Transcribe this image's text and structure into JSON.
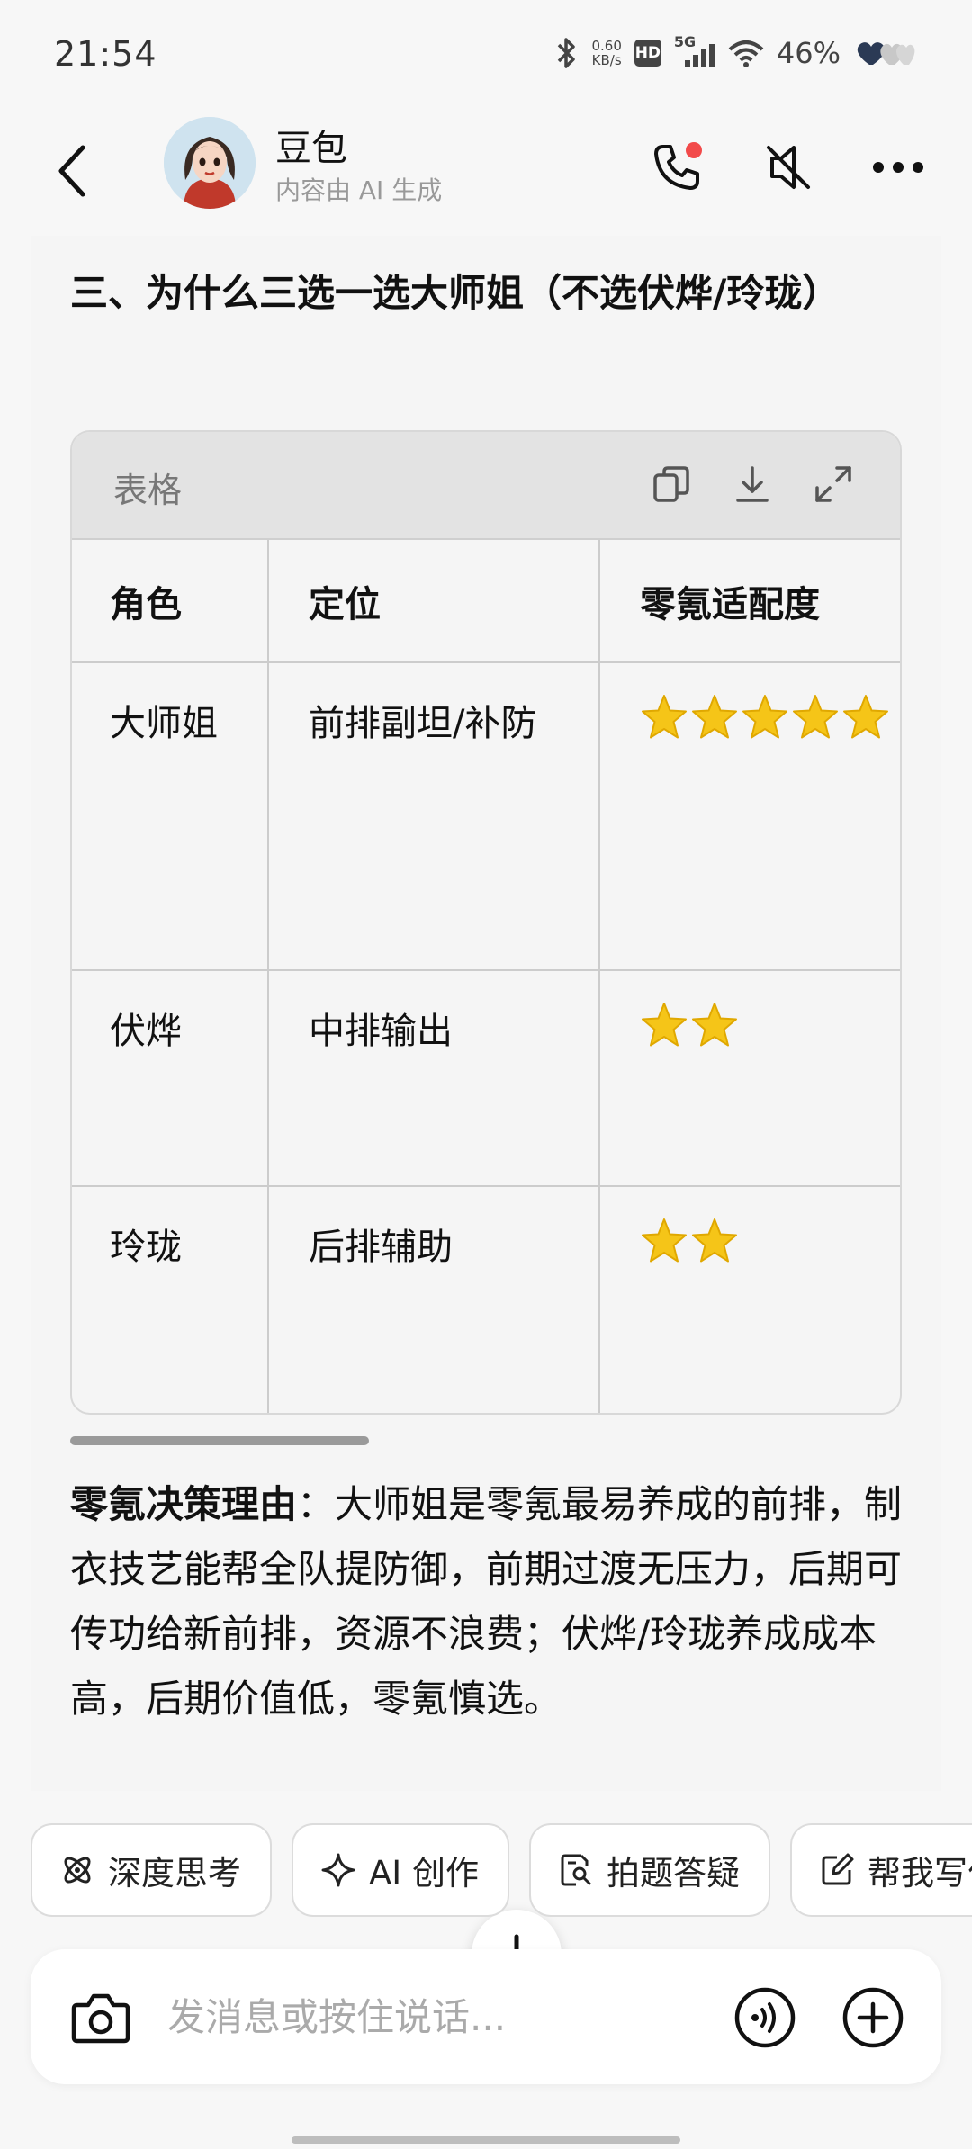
{
  "status_bar": {
    "time": "21:54",
    "net_speed_value": "0.60",
    "net_speed_unit": "KB/s",
    "hd_label": "HD",
    "signal_label": "5G",
    "battery_percent": "46%"
  },
  "header": {
    "contact_name": "豆包",
    "contact_subtitle": "内容由 AI 生成"
  },
  "message": {
    "section_title": "三、为什么三选一选大师姐（不选伏烨/玲珑）",
    "table": {
      "label": "表格",
      "columns": [
        "角色",
        "定位",
        "零氪适配度"
      ],
      "rows": [
        {
          "role": "大师姐",
          "position": "前排副坦/补防",
          "rating_stars": 5
        },
        {
          "role": "伏烨",
          "position": "中排输出",
          "rating_stars": 2
        },
        {
          "role": "玲珑",
          "position": "后排辅助",
          "rating_stars": 2
        }
      ]
    },
    "reason_label": "零氪决策理由",
    "reason_text": "：大师姐是零氪最易养成的前排，制衣技艺能帮全队提防御，前期过渡无压力，后期可传功给新前排，资源不浪费；伏烨/玲珑养成成本高，后期价值低，零氪慎选。"
  },
  "quick_actions": [
    {
      "label": "深度思考",
      "icon": "atom-icon"
    },
    {
      "label": "AI 创作",
      "icon": "sparkle-icon"
    },
    {
      "label": "拍题答疑",
      "icon": "doc-search-icon"
    },
    {
      "label": "帮我写作",
      "icon": "edit-icon"
    }
  ],
  "input": {
    "placeholder": "发消息或按住说话..."
  },
  "colors": {
    "accent_red": "#f24a4a",
    "star_yellow": "#f5c518"
  }
}
